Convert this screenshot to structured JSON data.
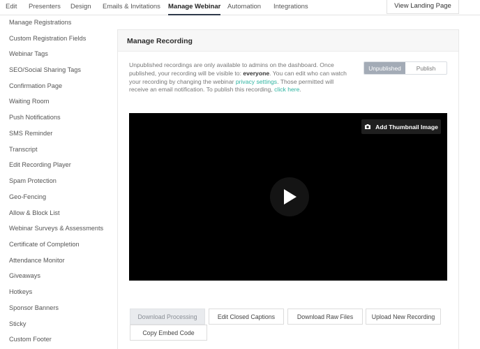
{
  "topnav": {
    "tabs": [
      {
        "label": "Edit"
      },
      {
        "label": "Presenters"
      },
      {
        "label": "Design"
      },
      {
        "label": "Emails & Invitations"
      },
      {
        "label": "Manage Webinar"
      },
      {
        "label": "Automation"
      },
      {
        "label": "Integrations"
      }
    ],
    "active_tab": "Manage Webinar",
    "landing_button": "View Landing Page"
  },
  "sidebar": {
    "items": [
      {
        "label": "Manage Registrations"
      },
      {
        "label": "Custom Registration Fields"
      },
      {
        "label": "Webinar Tags"
      },
      {
        "label": "SEO/Social Sharing Tags"
      },
      {
        "label": "Confirmation Page"
      },
      {
        "label": "Waiting Room"
      },
      {
        "label": "Push Notifications"
      },
      {
        "label": "SMS Reminder"
      },
      {
        "label": "Transcript"
      },
      {
        "label": "Edit Recording Player"
      },
      {
        "label": "Spam Protection"
      },
      {
        "label": "Geo-Fencing"
      },
      {
        "label": "Allow & Block List"
      },
      {
        "label": "Webinar Surveys & Assessments"
      },
      {
        "label": "Certificate of Completion"
      },
      {
        "label": "Attendance Monitor"
      },
      {
        "label": "Giveaways"
      },
      {
        "label": "Hotkeys"
      },
      {
        "label": "Sponsor Banners"
      },
      {
        "label": "Sticky"
      },
      {
        "label": "Custom Footer"
      }
    ]
  },
  "panel": {
    "title": "Manage Recording",
    "desc": {
      "p1": "Unpublished recordings are only available to admins on the dashboard. Once published, your recording will be visible to: ",
      "strong": "everyone",
      "p2": ". You can edit who can watch your recording by changing the webinar ",
      "link1": "privacy settings",
      "p3": ". Those permitted will receive an email notification. To publish this recording, ",
      "link2": "click here",
      "p4": "."
    },
    "toggle": {
      "unpublished": "Unpublished",
      "publish": "Publish",
      "selected": "Unpublished"
    },
    "video": {
      "thumbnail_button": "Add Thumbnail Image",
      "thumbnail_icon": "camera-icon",
      "play_icon": "play-icon"
    },
    "buttons": {
      "download_processing": "Download Processing",
      "edit_captions": "Edit Closed Captions",
      "download_raw": "Download Raw Files",
      "upload_new": "Upload New Recording",
      "copy_embed": "Copy Embed Code"
    }
  },
  "colors": {
    "accent_link": "#2fb4a1",
    "toggle_selected": "#a3abb6",
    "active_tab_underline": "#2f3a4a"
  }
}
